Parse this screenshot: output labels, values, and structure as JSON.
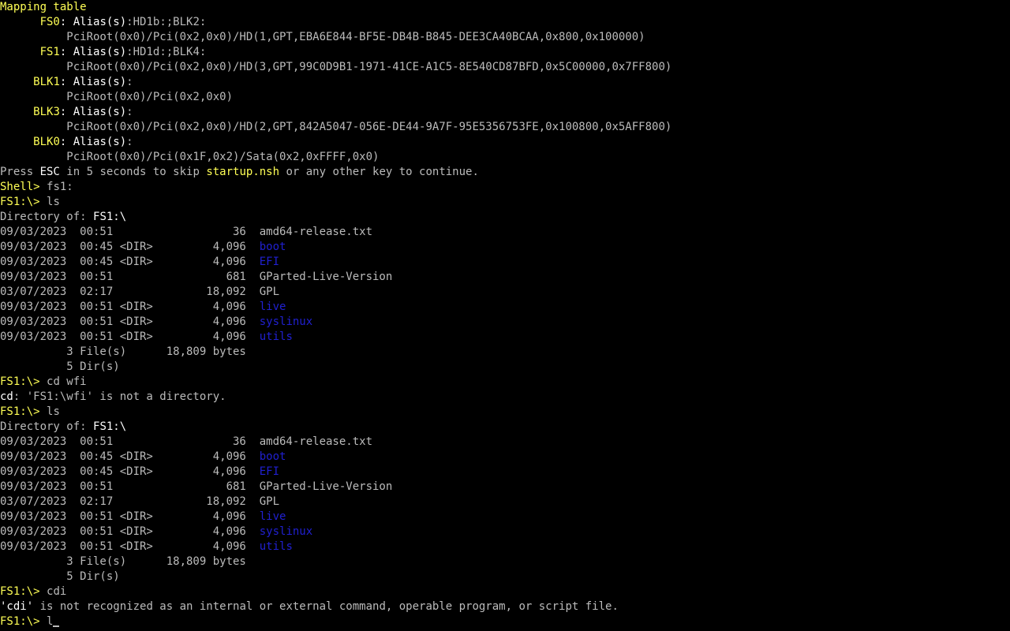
{
  "terminal": {
    "colors": {
      "normal": "#bbbbbb",
      "yellow": "#ffff55",
      "white": "#ffffff",
      "blue": "#2020d0",
      "background": "#000000"
    },
    "lines": [
      [
        {
          "t": "Mapping table",
          "c": "yellow"
        }
      ],
      [
        {
          "t": "      "
        },
        {
          "t": "FS0",
          "c": "yellow"
        },
        {
          "t": ": ",
          "c": "white"
        },
        {
          "t": "Alias(s)",
          "c": "white"
        },
        {
          "t": ":HD1b:;BLK2:"
        }
      ],
      [
        {
          "t": "          PciRoot(0x0)/Pci(0x2,0x0)/HD(1,GPT,EBA6E844-BF5E-DB4B-B845-DEE3CA40BCAA,0x800,0x100000)"
        }
      ],
      [
        {
          "t": "      "
        },
        {
          "t": "FS1",
          "c": "yellow"
        },
        {
          "t": ": ",
          "c": "white"
        },
        {
          "t": "Alias(s)",
          "c": "white"
        },
        {
          "t": ":HD1d:;BLK4:"
        }
      ],
      [
        {
          "t": "          PciRoot(0x0)/Pci(0x2,0x0)/HD(3,GPT,99C0D9B1-1971-41CE-A1C5-8E540CD87BFD,0x5C00000,0x7FF800)"
        }
      ],
      [
        {
          "t": "     "
        },
        {
          "t": "BLK1",
          "c": "yellow"
        },
        {
          "t": ": ",
          "c": "white"
        },
        {
          "t": "Alias(s)",
          "c": "white"
        },
        {
          "t": ":"
        }
      ],
      [
        {
          "t": "          PciRoot(0x0)/Pci(0x2,0x0)"
        }
      ],
      [
        {
          "t": "     "
        },
        {
          "t": "BLK3",
          "c": "yellow"
        },
        {
          "t": ": ",
          "c": "white"
        },
        {
          "t": "Alias(s)",
          "c": "white"
        },
        {
          "t": ":"
        }
      ],
      [
        {
          "t": "          PciRoot(0x0)/Pci(0x2,0x0)/HD(2,GPT,842A5047-056E-DE44-9A7F-95E5356753FE,0x100800,0x5AFF800)"
        }
      ],
      [
        {
          "t": "     "
        },
        {
          "t": "BLK0",
          "c": "yellow"
        },
        {
          "t": ": ",
          "c": "white"
        },
        {
          "t": "Alias(s)",
          "c": "white"
        },
        {
          "t": ":"
        }
      ],
      [
        {
          "t": "          PciRoot(0x0)/Pci(0x1F,0x2)/Sata(0x2,0xFFFF,0x0)"
        }
      ],
      [
        {
          "t": "Press "
        },
        {
          "t": "ESC",
          "c": "white"
        },
        {
          "t": " in 5 seconds to skip "
        },
        {
          "t": "startup.nsh",
          "c": "yellow"
        },
        {
          "t": " or any other key to continue."
        }
      ],
      [
        {
          "t": "Shell> ",
          "c": "yellow"
        },
        {
          "t": "fs1:"
        }
      ],
      [
        {
          "t": "FS1:\\> ",
          "c": "yellow"
        },
        {
          "t": "ls"
        }
      ],
      [
        {
          "t": "Directory of: "
        },
        {
          "t": "FS1:\\",
          "c": "white"
        }
      ],
      [
        {
          "t": "09/03/2023  00:51                  36  amd64-release.txt"
        }
      ],
      [
        {
          "t": "09/03/2023  00:45 <DIR>         4,096  "
        },
        {
          "t": "boot",
          "c": "blue"
        }
      ],
      [
        {
          "t": "09/03/2023  00:45 <DIR>         4,096  "
        },
        {
          "t": "EFI",
          "c": "blue"
        }
      ],
      [
        {
          "t": "09/03/2023  00:51                 681  GParted-Live-Version"
        }
      ],
      [
        {
          "t": "03/07/2023  02:17              18,092  GPL"
        }
      ],
      [
        {
          "t": "09/03/2023  00:51 <DIR>         4,096  "
        },
        {
          "t": "live",
          "c": "blue"
        }
      ],
      [
        {
          "t": "09/03/2023  00:51 <DIR>         4,096  "
        },
        {
          "t": "syslinux",
          "c": "blue"
        }
      ],
      [
        {
          "t": "09/03/2023  00:51 <DIR>         4,096  "
        },
        {
          "t": "utils",
          "c": "blue"
        }
      ],
      [
        {
          "t": "          3 File(s)      18,809 bytes"
        }
      ],
      [
        {
          "t": "          5 Dir(s)"
        }
      ],
      [
        {
          "t": "FS1:\\> ",
          "c": "yellow"
        },
        {
          "t": "cd wfi"
        }
      ],
      [
        {
          "t": "cd",
          "c": "white"
        },
        {
          "t": ": 'FS1:\\wfi' is not a directory."
        }
      ],
      [
        {
          "t": "FS1:\\> ",
          "c": "yellow"
        },
        {
          "t": "ls"
        }
      ],
      [
        {
          "t": "Directory of: "
        },
        {
          "t": "FS1:\\",
          "c": "white"
        }
      ],
      [
        {
          "t": "09/03/2023  00:51                  36  amd64-release.txt"
        }
      ],
      [
        {
          "t": "09/03/2023  00:45 <DIR>         4,096  "
        },
        {
          "t": "boot",
          "c": "blue"
        }
      ],
      [
        {
          "t": "09/03/2023  00:45 <DIR>         4,096  "
        },
        {
          "t": "EFI",
          "c": "blue"
        }
      ],
      [
        {
          "t": "09/03/2023  00:51                 681  GParted-Live-Version"
        }
      ],
      [
        {
          "t": "03/07/2023  02:17              18,092  GPL"
        }
      ],
      [
        {
          "t": "09/03/2023  00:51 <DIR>         4,096  "
        },
        {
          "t": "live",
          "c": "blue"
        }
      ],
      [
        {
          "t": "09/03/2023  00:51 <DIR>         4,096  "
        },
        {
          "t": "syslinux",
          "c": "blue"
        }
      ],
      [
        {
          "t": "09/03/2023  00:51 <DIR>         4,096  "
        },
        {
          "t": "utils",
          "c": "blue"
        }
      ],
      [
        {
          "t": "          3 File(s)      18,809 bytes"
        }
      ],
      [
        {
          "t": "          5 Dir(s)"
        }
      ],
      [
        {
          "t": "FS1:\\> ",
          "c": "yellow"
        },
        {
          "t": "cdi"
        }
      ],
      [
        {
          "t": "'cdi'",
          "c": "white"
        },
        {
          "t": " is not recognized as an internal or external command, operable program, or script file."
        }
      ],
      [
        {
          "t": "FS1:\\> ",
          "c": "yellow"
        },
        {
          "t": "l"
        },
        {
          "cursor": true
        }
      ]
    ]
  }
}
